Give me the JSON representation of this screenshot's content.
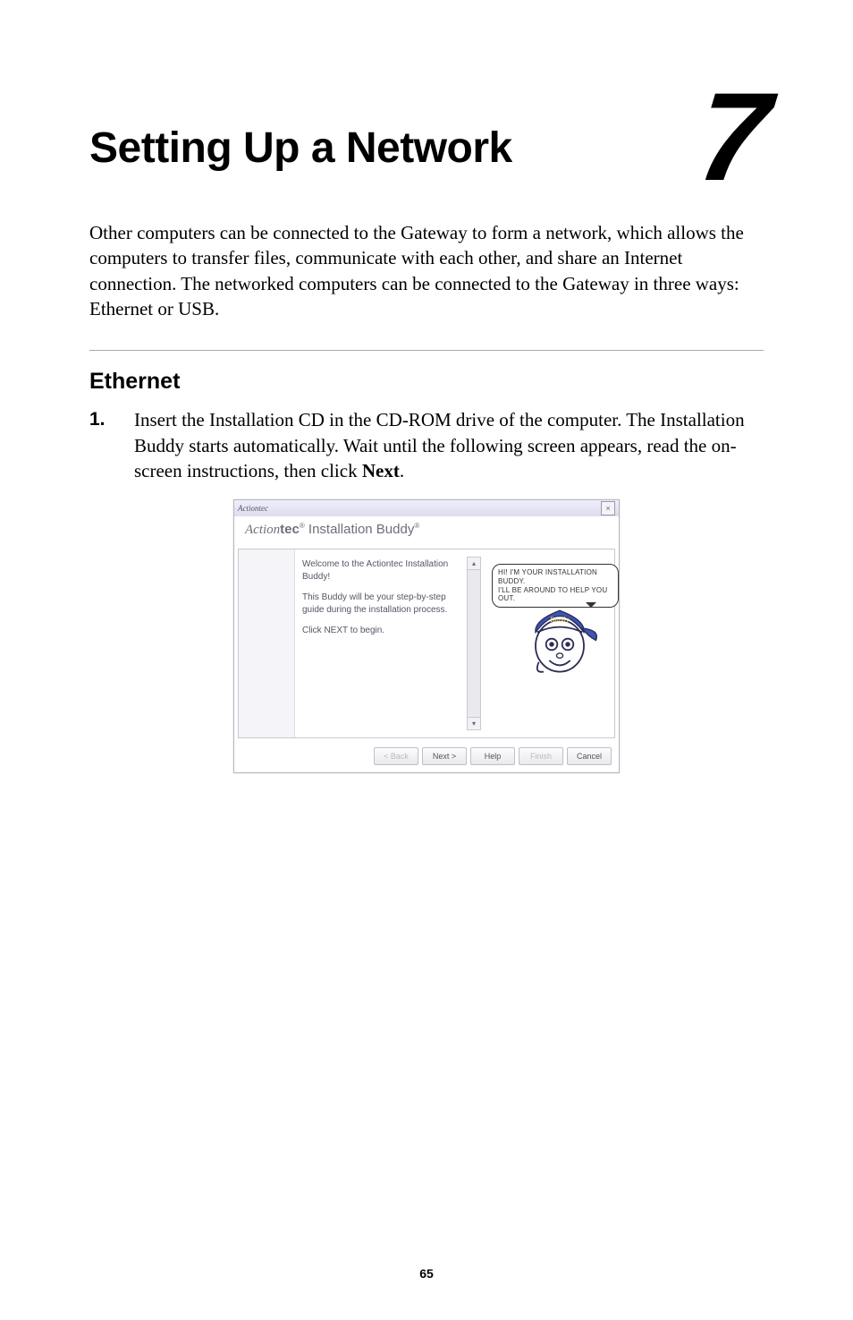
{
  "chapter": {
    "title": "Setting Up a Network",
    "number": "7"
  },
  "intro": "Other computers can be connected to the Gateway to form a network, which allows the computers to transfer files, communicate with each other, and share an Internet connection. The networked computers can be connected to the Gateway in three ways: Ethernet or USB.",
  "section": {
    "heading": "Ethernet"
  },
  "step1": {
    "number": "1.",
    "text_before": "Insert the Installation ",
    "cd": "CD",
    "text_mid": " in the ",
    "cdrom": "CD-ROM",
    "text_after": " drive of the computer. The Installation Buddy starts automatically. Wait until the following screen appears, read the on-screen instructions, then click ",
    "next_label": "Next",
    "period": "."
  },
  "installer": {
    "titlebar_brand": "Actiontec",
    "close_glyph": "×",
    "brand_action": "Action",
    "brand_tec": "tec",
    "brand_reg": "®",
    "brand_inst": " Installation Buddy",
    "brand_reg2": "®",
    "body": {
      "line1": "Welcome to the Actiontec Installation Buddy!",
      "line2": "This Buddy will be your step-by-step guide during the installation process.",
      "line3": "Click NEXT to begin."
    },
    "speech": {
      "line1": "Hi! I'm your installation buddy.",
      "line2": "I'll be around to help you out."
    },
    "buddy_cap": "Buddy",
    "scroll_up": "▴",
    "scroll_down": "▾",
    "buttons": {
      "back": "< Back",
      "next": "Next >",
      "help": "Help",
      "finish": "Finish",
      "cancel": "Cancel"
    }
  },
  "page_number": "65",
  "chart_data": null
}
